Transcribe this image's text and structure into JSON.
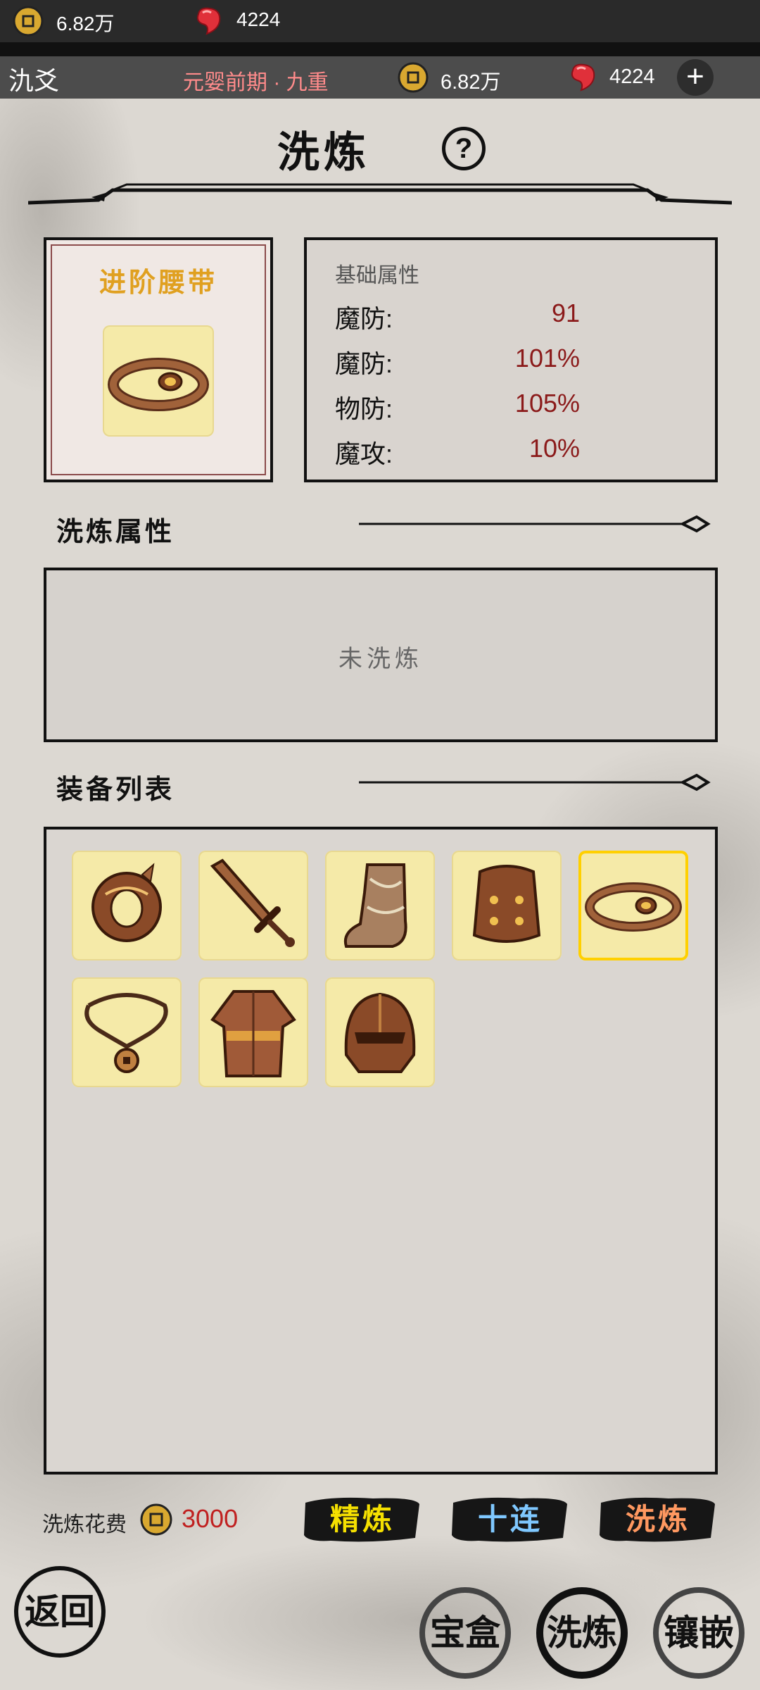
{
  "status_bar": {
    "coins": "6.82万",
    "gems": "4224"
  },
  "header": {
    "player_name": "氿爻",
    "realm": "元婴前期 · 九重",
    "coins": "6.82万",
    "gems": "4224",
    "add_label": "+"
  },
  "title": "洗炼",
  "help_label": "?",
  "item": {
    "name": "进阶腰带",
    "icon": "belt-icon"
  },
  "base_attributes": {
    "heading": "基础属性",
    "rows": [
      {
        "label": "魔防:",
        "value": "91"
      },
      {
        "label": "魔防:",
        "value": "101%"
      },
      {
        "label": "物防:",
        "value": "105%"
      },
      {
        "label": "魔攻:",
        "value": "10%"
      }
    ]
  },
  "refine_section": {
    "title": "洗炼属性",
    "empty_text": "未洗炼"
  },
  "equip_section": {
    "title": "装备列表",
    "items": [
      {
        "icon": "ring-icon",
        "selected": false
      },
      {
        "icon": "sword-icon",
        "selected": false
      },
      {
        "icon": "boots-icon",
        "selected": false
      },
      {
        "icon": "armor-icon",
        "selected": false
      },
      {
        "icon": "belt-icon",
        "selected": true
      },
      {
        "icon": "necklace-icon",
        "selected": false
      },
      {
        "icon": "robe-icon",
        "selected": false
      },
      {
        "icon": "helmet-icon",
        "selected": false
      }
    ]
  },
  "cost": {
    "label": "洗炼花费",
    "value": "3000"
  },
  "actions": {
    "refine_plus": "精炼",
    "ten_pull": "十连",
    "refine": "洗炼"
  },
  "bottom_nav": {
    "back": "返回",
    "treasure": "宝盒",
    "refine": "洗炼",
    "inlay": "镶嵌"
  },
  "colors": {
    "accent_gold": "#e0a020",
    "stat_red": "#8b1a1a",
    "realm_pink": "#ff8b8b",
    "slot_bg": "#f5eaa8"
  }
}
